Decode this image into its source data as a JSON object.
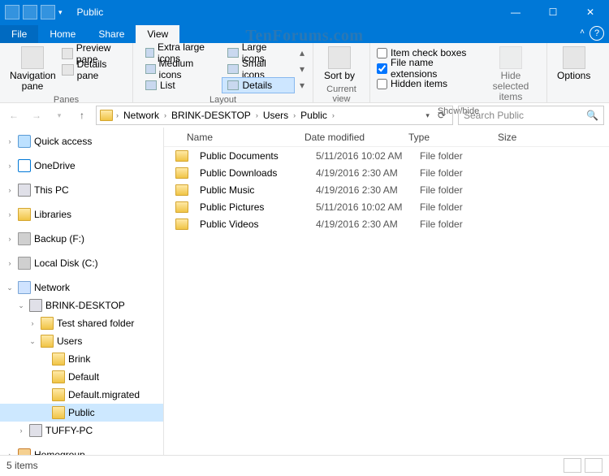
{
  "window": {
    "title": "Public"
  },
  "watermark": "TenForums.com",
  "ribbon_tabs": {
    "file": "File",
    "home": "Home",
    "share": "Share",
    "view": "View"
  },
  "ribbon": {
    "panes": {
      "nav": "Navigation pane",
      "preview": "Preview pane",
      "details_pane": "Details pane",
      "label": "Panes"
    },
    "layout": {
      "xl": "Extra large icons",
      "lg": "Large icons",
      "md": "Medium icons",
      "sm": "Small icons",
      "list": "List",
      "details": "Details",
      "label": "Layout"
    },
    "current": {
      "sort": "Sort by",
      "label": "Current view"
    },
    "showhide": {
      "item_check": "Item check boxes",
      "ext": "File name extensions",
      "hidden": "Hidden items",
      "hide_sel": "Hide selected items",
      "label": "Show/hide"
    },
    "options": "Options"
  },
  "address": {
    "crumbs": [
      "Network",
      "BRINK-DESKTOP",
      "Users",
      "Public"
    ],
    "search_placeholder": "Search Public"
  },
  "tree": {
    "quick": "Quick access",
    "onedrive": "OneDrive",
    "thispc": "This PC",
    "libraries": "Libraries",
    "backup": "Backup (F:)",
    "localc": "Local Disk (C:)",
    "network": "Network",
    "brink": "BRINK-DESKTOP",
    "testshared": "Test shared folder",
    "users": "Users",
    "u_brink": "Brink",
    "u_default": "Default",
    "u_defmig": "Default.migrated",
    "u_public": "Public",
    "tuffy": "TUFFY-PC",
    "homegroup": "Homegroup"
  },
  "columns": {
    "name": "Name",
    "date": "Date modified",
    "type": "Type",
    "size": "Size"
  },
  "rows": [
    {
      "name": "Public Documents",
      "date": "5/11/2016 10:02 AM",
      "type": "File folder",
      "size": ""
    },
    {
      "name": "Public Downloads",
      "date": "4/19/2016 2:30 AM",
      "type": "File folder",
      "size": ""
    },
    {
      "name": "Public Music",
      "date": "4/19/2016 2:30 AM",
      "type": "File folder",
      "size": ""
    },
    {
      "name": "Public Pictures",
      "date": "5/11/2016 10:02 AM",
      "type": "File folder",
      "size": ""
    },
    {
      "name": "Public Videos",
      "date": "4/19/2016 2:30 AM",
      "type": "File folder",
      "size": ""
    }
  ],
  "status": {
    "count": "5 items"
  }
}
